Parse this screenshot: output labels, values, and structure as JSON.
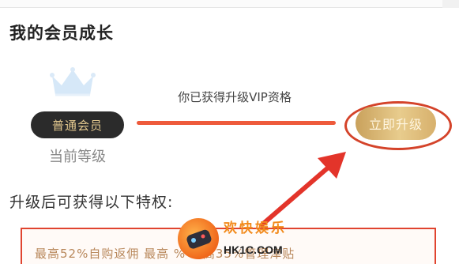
{
  "growth_section": {
    "title": "我的会员成长",
    "current_level": {
      "badge_label": "普通会员",
      "caption": "当前等级"
    },
    "progress_caption": "你已获得升级VIP资格",
    "upgrade_button_label": "立即升级"
  },
  "privileges": {
    "title": "升级后可获得以下特权:",
    "benefit_text": "最高52%自购返佣   最高 %           最高35%管理津贴"
  },
  "watermark": {
    "title": "欢快娱乐",
    "url": "HK1C.COM"
  },
  "colors": {
    "accent_red": "#ee5a3b",
    "gold": "#d7b06c",
    "badge_dark": "#2b2b2b",
    "crown_blue": "#cfe3f6"
  },
  "icons": {
    "crown": "crown-icon",
    "arrow": "arrow-annotation",
    "gamepad_logo": "gamepad-logo"
  }
}
